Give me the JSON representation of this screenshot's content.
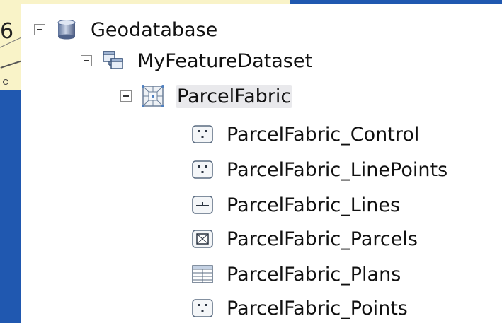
{
  "background_map": {
    "fragment_digit": "6"
  },
  "tree": {
    "root": {
      "label": "Geodatabase",
      "icon": "geodatabase-icon",
      "expanded": true
    },
    "dataset": {
      "label": "MyFeatureDataset",
      "icon": "feature-dataset-icon",
      "expanded": true
    },
    "fabric": {
      "label": "ParcelFabric",
      "icon": "parcel-fabric-icon",
      "expanded": true,
      "selected": true
    },
    "children": [
      {
        "label": "ParcelFabric_Control",
        "icon": "point-feature-class-icon"
      },
      {
        "label": "ParcelFabric_LinePoints",
        "icon": "point-feature-class-icon"
      },
      {
        "label": "ParcelFabric_Lines",
        "icon": "line-feature-class-icon"
      },
      {
        "label": "ParcelFabric_Parcels",
        "icon": "polygon-feature-class-icon"
      },
      {
        "label": "ParcelFabric_Plans",
        "icon": "table-icon"
      },
      {
        "label": "ParcelFabric_Points",
        "icon": "point-feature-class-icon"
      }
    ]
  },
  "colors": {
    "desktop_blue": "#2058b0",
    "map_yellow": "#f9f3c8",
    "panel_white": "#ffffff",
    "selection_gray": "#e9e9ec"
  }
}
